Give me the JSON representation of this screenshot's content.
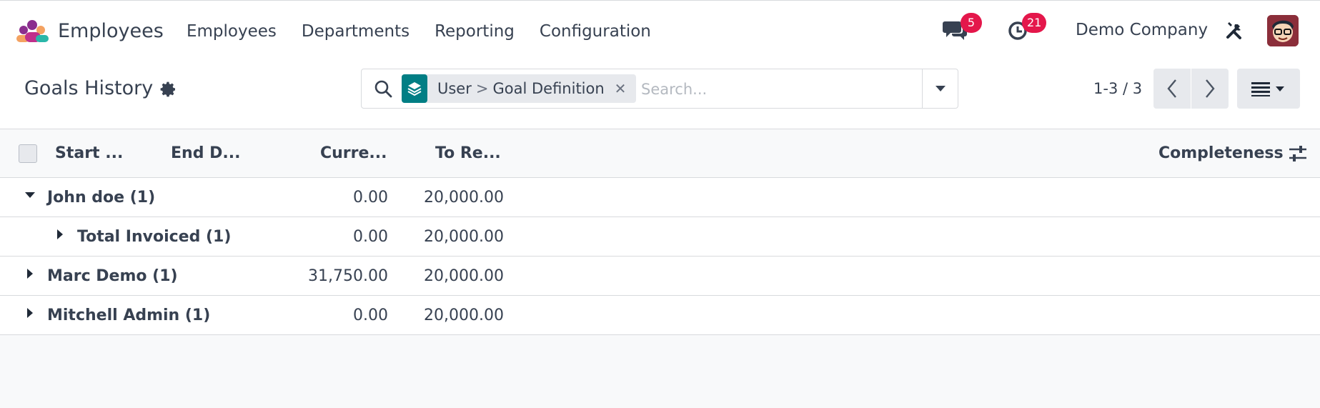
{
  "app": {
    "name": "Employees",
    "colors": {
      "accent": "#017e84",
      "badge": "#e4174b",
      "brand_purple": "#8b2e8e",
      "brand_orange": "#f4a261",
      "brand_teal": "#2ab7a9"
    }
  },
  "navbar": {
    "menu": [
      "Employees",
      "Departments",
      "Reporting",
      "Configuration"
    ],
    "chat_badge": "5",
    "activity_badge": "21",
    "company": "Demo Company",
    "icons": {
      "chat": "chat-bubbles-icon",
      "activity": "clock-icon",
      "debug": "tools-icon",
      "avatar": "user-avatar"
    }
  },
  "control_panel": {
    "title": "Goals History",
    "facet": {
      "first": "User",
      "separator": ">",
      "second": "Goal Definition"
    },
    "search_placeholder": "Search...",
    "pager": "1-3 / 3"
  },
  "list": {
    "columns": {
      "start": "Start ...",
      "end": "End D...",
      "current": "Curre...",
      "target": "To Re...",
      "completeness": "Completeness"
    },
    "rows": [
      {
        "label": "John doe (1)",
        "current": "0.00",
        "target": "20,000.00",
        "expanded": true
      },
      {
        "label": "Total Invoiced (1)",
        "current": "0.00",
        "target": "20,000.00",
        "expanded": false
      },
      {
        "label": "Marc Demo (1)",
        "current": "31,750.00",
        "target": "20,000.00",
        "expanded": false
      },
      {
        "label": "Mitchell Admin (1)",
        "current": "0.00",
        "target": "20,000.00",
        "expanded": false
      }
    ]
  }
}
